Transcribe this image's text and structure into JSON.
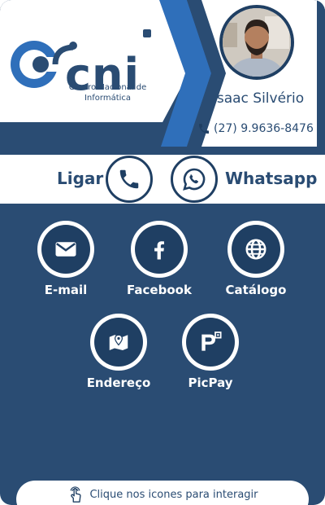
{
  "brand": {
    "name": "cni",
    "caption": "Centro Nacional de Informática"
  },
  "profile": {
    "name": "Isaac Silvério",
    "phone": "(27) 9.9636-8476"
  },
  "quick_actions": {
    "call_label": "Ligar",
    "whatsapp_label": "Whatsapp"
  },
  "links": [
    {
      "label": "E-mail",
      "icon": "envelope-icon"
    },
    {
      "label": "Facebook",
      "icon": "facebook-icon"
    },
    {
      "label": "Catálogo",
      "icon": "globe-icon"
    },
    {
      "label": "Endereço",
      "icon": "map-pin-icon"
    },
    {
      "label": "PicPay",
      "icon": "picpay-icon"
    }
  ],
  "hint": "Clique nos icones para interagir",
  "colors": {
    "navy": "#2a4c73",
    "dark_navy": "#1f3f63",
    "accent_blue": "#2f6fba",
    "white": "#ffffff"
  }
}
